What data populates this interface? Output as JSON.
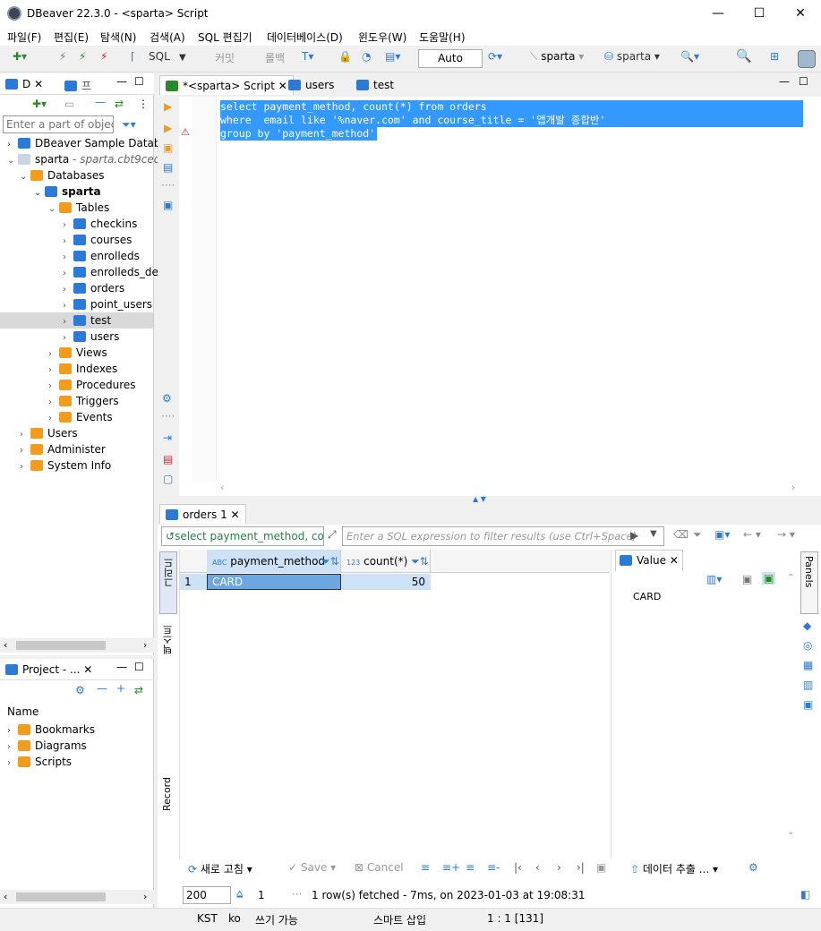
{
  "window": {
    "title": "DBeaver 22.3.0 - <sparta> Script"
  },
  "menu": [
    "파일(F)",
    "편집(E)",
    "탐색(N)",
    "검색(A)",
    "SQL 편집기",
    "데이터베이스(D)",
    "윈도우(W)",
    "도움말(H)"
  ],
  "toolbar": {
    "sql_label": "SQL",
    "commit_label": "커밋",
    "rollback_label": "롤백",
    "mode": "Auto",
    "datasource": "sparta",
    "schema": "sparta"
  },
  "nav_panel": {
    "tab1": "D",
    "tab2": "프",
    "filter_placeholder": "Enter a part of object",
    "tree": {
      "sample_db": "DBeaver Sample Databa",
      "conn": "sparta",
      "conn_desc": "- sparta.cbt9ceq",
      "databases": "Databases",
      "db": "sparta",
      "tables": "Tables",
      "table_items": [
        "checkins",
        "courses",
        "enrolleds",
        "enrolleds_de",
        "orders",
        "point_users",
        "test",
        "users"
      ],
      "views": "Views",
      "indexes": "Indexes",
      "procedures": "Procedures",
      "triggers": "Triggers",
      "events": "Events",
      "users": "Users",
      "administer": "Administer",
      "system_info": "System Info"
    }
  },
  "project_panel": {
    "tab": "Project - ...",
    "header": "Name",
    "items": [
      "Bookmarks",
      "Diagrams",
      "Scripts"
    ]
  },
  "editor": {
    "tabs": [
      "*<sparta> Script",
      "users",
      "test"
    ],
    "lines": [
      "select payment_method, count(*) from orders",
      "where  email like '%naver.com' and course_title = '앱개발 종합반'",
      "group by 'payment_method'"
    ]
  },
  "results": {
    "tab": "orders 1",
    "query_label": "select payment_method, cou",
    "filter_placeholder": "Enter a SQL expression to filter results (use Ctrl+Space)",
    "side_grid": "그리드",
    "side_text": "텍스트",
    "side_record": "Record",
    "columns": [
      {
        "type": "ABC",
        "name": "payment_method"
      },
      {
        "type": "123",
        "name": "count(*)"
      }
    ],
    "rows": [
      {
        "num": "1",
        "payment_method": "CARD",
        "count": "50"
      }
    ],
    "value_panel": {
      "title": "Value",
      "content": "CARD"
    },
    "panels_label": "Panels",
    "bottom": {
      "refresh": "새로 고침",
      "save": "Save",
      "cancel": "Cancel",
      "export": "데이터 추출 ...",
      "fetch_size": "200",
      "count": "1",
      "status": "1 row(s) fetched - 7ms, on 2023-01-03 at 19:08:31"
    }
  },
  "statusbar": {
    "tz": "KST",
    "locale": "ko",
    "mode": "쓰기 가능",
    "insert": "스마트 삽입",
    "pos": "1 : 1 [131]"
  }
}
